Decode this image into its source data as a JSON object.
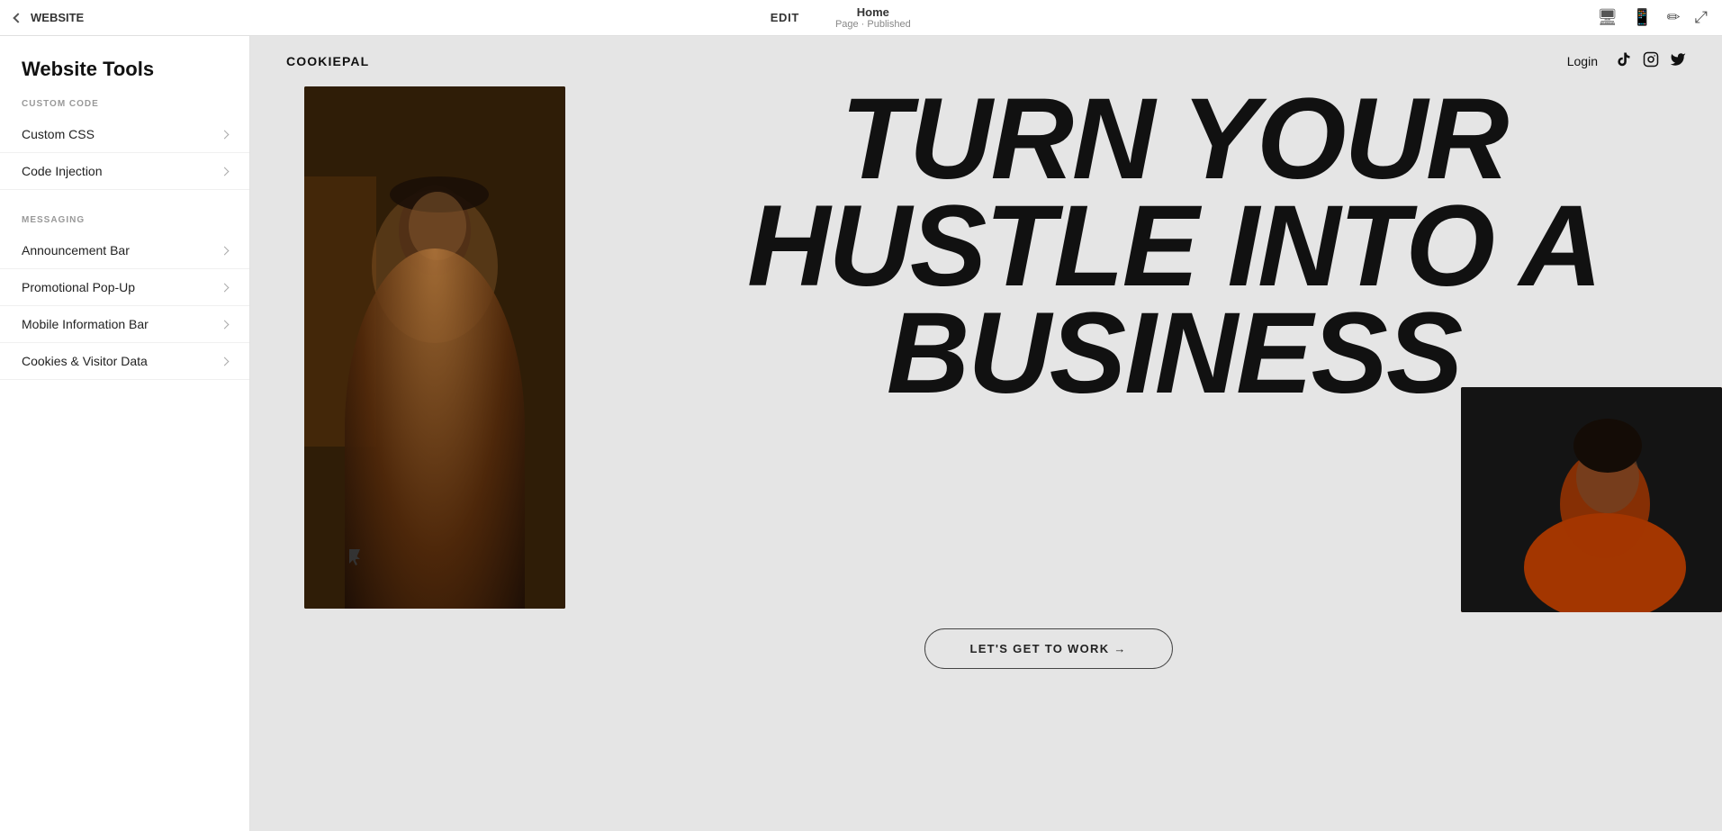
{
  "topbar": {
    "back_label": "WEBSITE",
    "edit_label": "EDIT",
    "page_title": "Home",
    "page_status": "Page · Published"
  },
  "sidebar": {
    "title": "Website Tools",
    "sections": [
      {
        "label": "CUSTOM CODE",
        "items": [
          {
            "id": "custom-css",
            "label": "Custom CSS"
          },
          {
            "id": "code-injection",
            "label": "Code Injection"
          }
        ]
      },
      {
        "label": "MESSAGING",
        "items": [
          {
            "id": "announcement-bar",
            "label": "Announcement Bar"
          },
          {
            "id": "promotional-popup",
            "label": "Promotional Pop-Up"
          },
          {
            "id": "mobile-information-bar",
            "label": "Mobile Information Bar"
          },
          {
            "id": "cookies-visitor-data",
            "label": "Cookies & Visitor Data"
          }
        ]
      }
    ]
  },
  "preview": {
    "logo": "COOKIEPAL",
    "nav_login": "Login",
    "social_icons": [
      "tiktok",
      "instagram",
      "twitter"
    ],
    "headline_line1": "TURN YOUR",
    "headline_line2": "HUSTLE INTO A",
    "headline_line3": "BUSINESS",
    "cta_label": "LET'S GET TO WORK →"
  },
  "icons": {
    "desktop": "🖥",
    "mobile": "📱",
    "pen": "✏",
    "expand": "⤢"
  }
}
